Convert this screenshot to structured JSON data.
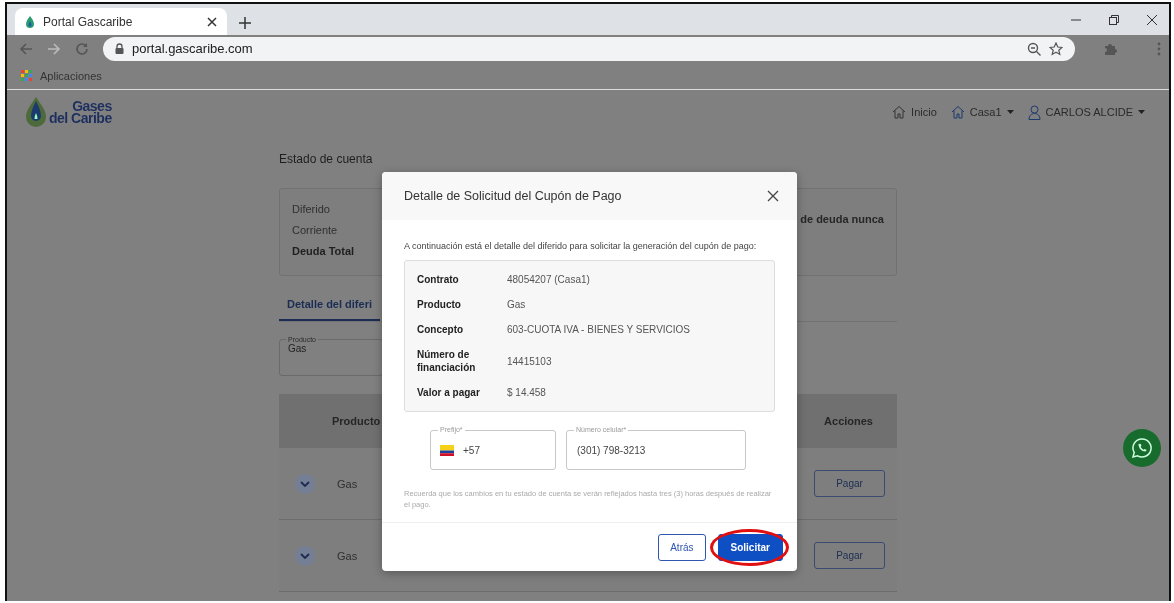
{
  "browser": {
    "tab_title": "Portal Gascaribe",
    "url": "portal.gascaribe.com",
    "bookmarks": [
      "Aplicaciones"
    ]
  },
  "site_header": {
    "logo_lines": [
      "Gases",
      "del Caribe"
    ],
    "nav": [
      {
        "label": "Inicio",
        "kind": "home",
        "dropdown": false
      },
      {
        "label": "Casa1",
        "kind": "home",
        "dropdown": true
      },
      {
        "label": "CARLOS ALCIDE",
        "kind": "user",
        "dropdown": true
      }
    ]
  },
  "page": {
    "title": "Estado de cuenta",
    "summary": [
      {
        "label": "Diferido",
        "kind": "line"
      },
      {
        "label": "Corriente",
        "kind": "line"
      },
      {
        "label": "Deuda Total",
        "kind": "total"
      }
    ],
    "summary_note": "de deuda nunca",
    "tabs": [
      {
        "label": "Detalle del diferi",
        "selected": true
      }
    ],
    "filter": {
      "label": "Producto",
      "value": "Gas"
    },
    "table": {
      "columns": [
        "Producto",
        "Acciones"
      ],
      "rows": [
        {
          "product": "Gas",
          "action": "Pagar"
        },
        {
          "product": "Gas",
          "action": "Pagar"
        }
      ]
    }
  },
  "modal": {
    "title": "Detalle de Solicitud del Cupón de Pago",
    "intro": "A continuación está el detalle del diferido para solicitar la generación del cupón de pago:",
    "details": [
      {
        "label": "Contrato",
        "value": "48054207 (Casa1)"
      },
      {
        "label": "Producto",
        "value": "Gas"
      },
      {
        "label": "Concepto",
        "value": "603-CUOTA IVA - BIENES Y SERVICIOS"
      },
      {
        "label": "Número de financiación",
        "value": "14415103"
      },
      {
        "label": "Valor a pagar",
        "value": "$ 14.458"
      }
    ],
    "fields": [
      {
        "kind": "prefix",
        "label": "Prefijo*",
        "value": "+57"
      },
      {
        "kind": "text",
        "label": "Número celular*",
        "value": "(301) 798-3213"
      }
    ],
    "note": "Recuerda que los cambios en tu estado de cuenta se verán reflejados hasta tres (3) horas después de realizar el pago.",
    "buttons": [
      {
        "label": "Atrás",
        "kind": "secondary",
        "circled": false
      },
      {
        "label": "Solicitar",
        "kind": "primary",
        "circled": true
      }
    ]
  }
}
